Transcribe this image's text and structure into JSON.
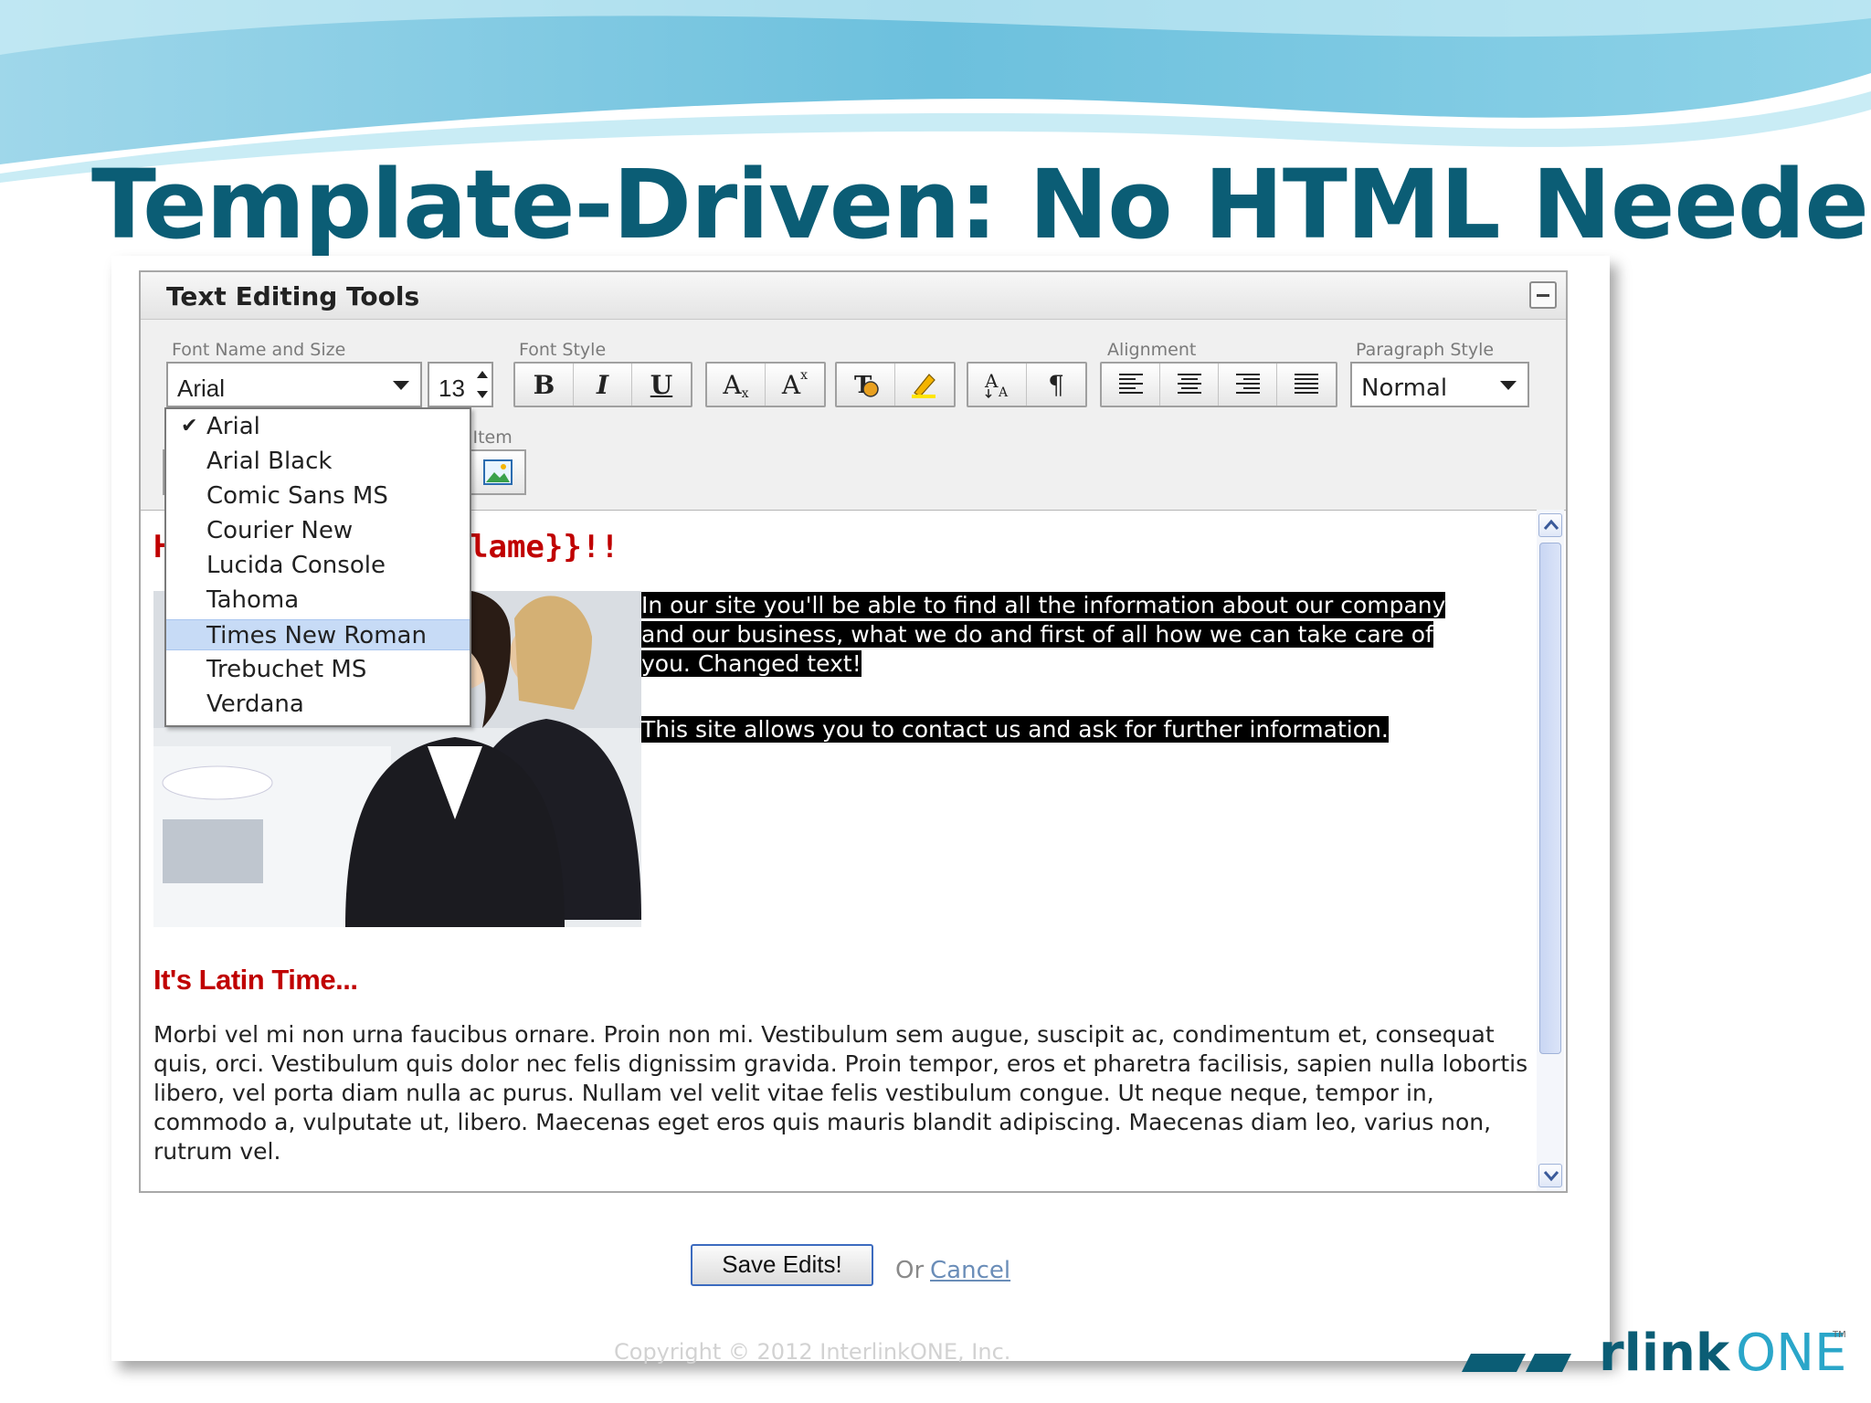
{
  "slide": {
    "title": "Template-Driven: No HTML Needed"
  },
  "panel": {
    "title": "Text Editing Tools"
  },
  "toolbar": {
    "font_group_label": "Font Name and Size",
    "font_name": "Arial",
    "font_size": "13",
    "font_style_label": "Font Style",
    "alignment_label": "Alignment",
    "paragraph_style_label": "Paragraph Style",
    "paragraph_style": "Normal",
    "insert_item_label": "t Item",
    "buttons": {
      "bold": "B",
      "italic": "I",
      "underline": "U",
      "subscript": "A",
      "superscript": "A",
      "pilcrow": "¶"
    }
  },
  "font_dropdown": {
    "items": [
      "Arial",
      "Arial Black",
      "Comic Sans MS",
      "Courier New",
      "Lucida Console",
      "Tahoma",
      "Times New Roman",
      "Trebuchet MS",
      "Verdana"
    ],
    "checked": "Arial",
    "highlighted": "Times New Roman"
  },
  "editor": {
    "heading_left": "H",
    "heading_right": "lame}}!!",
    "para1_lines": [
      "In our site you'll be able to find all the information about our company",
      "and our business, what we do and first of all how we can take care of",
      "you. Changed text!"
    ],
    "para2": "This site allows you to contact us and ask for further information.",
    "latin_heading": "It's Latin Time...",
    "latin_body": "Morbi vel mi non urna faucibus ornare. Proin non mi. Vestibulum sem augue, suscipit ac, condimentum et, consequat quis, orci. Vestibulum quis dolor nec felis dignissim gravida. Proin tempor, eros et pharetra facilisis, sapien nulla lobortis libero, vel porta diam nulla ac purus. Nullam vel velit vitae felis vestibulum congue. Ut neque neque, tempor in, commodo a, vulputate ut, libero. Maecenas eget eros quis mauris blandit adipiscing. Maecenas diam leo, varius non, rutrum vel."
  },
  "actions": {
    "save": "Save Edits!",
    "or": "Or",
    "cancel": "Cancel"
  },
  "footer": {
    "copyright": "Copyright © 2012 InterlinkONE, Inc.",
    "logo_text": "rlinkONE",
    "logo_tm": "TM"
  },
  "colors": {
    "title": "#0b5d75",
    "heading_red": "#c00000",
    "selection": "#c7dbf6",
    "save_border": "#3c6bbf"
  }
}
